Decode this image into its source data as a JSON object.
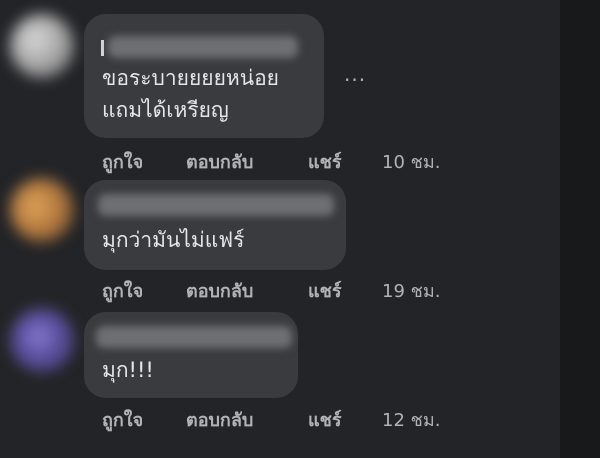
{
  "comments": [
    {
      "text": "ขอระบายยยยหน่อย\nแถมได้เหรียญ",
      "like_label": "ถูกใจ",
      "reply_label": "ตอบกลับ",
      "share_label": "แชร์",
      "time": "10 ชม.",
      "more_label": "..."
    },
    {
      "text": "มุกว่ามันไม่แฟร์",
      "like_label": "ถูกใจ",
      "reply_label": "ตอบกลับ",
      "share_label": "แชร์",
      "time": "19 ชม."
    },
    {
      "text": "มุก!!!",
      "like_label": "ถูกใจ",
      "reply_label": "ตอบกลับ",
      "share_label": "แชร์",
      "time": "12 ชม."
    }
  ],
  "colors": {
    "background": "#18191a",
    "panel": "#232427",
    "bubble": "#3a3b3e",
    "text": "#e4e6eb",
    "secondary_text": "#b0b3b8"
  }
}
